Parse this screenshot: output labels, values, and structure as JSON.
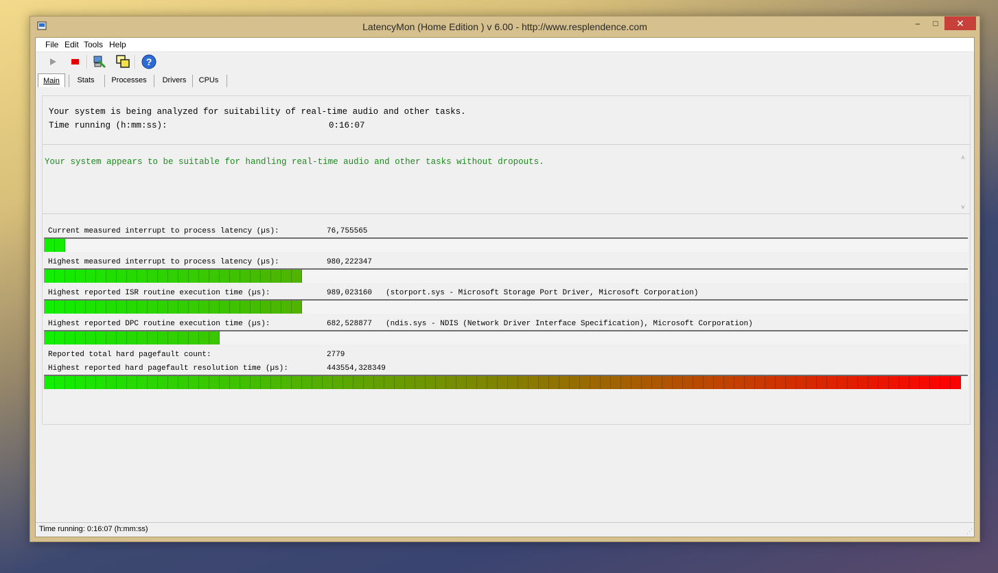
{
  "window": {
    "title": "LatencyMon  (Home Edition )  v 6.00 - http://www.resplendence.com",
    "min_glyph": "–",
    "max_glyph": "□",
    "close_glyph": "✕"
  },
  "menu": [
    "File",
    "Edit",
    "Tools",
    "Help"
  ],
  "toolbar": {
    "icons": [
      "play-icon",
      "stop-icon",
      "pc-tools-icon",
      "windows-icon",
      "help-icon"
    ],
    "help_glyph": "?"
  },
  "tabs": [
    "Main",
    "Stats",
    "Processes",
    "Drivers",
    "CPUs"
  ],
  "active_tab": "Main",
  "main": {
    "analyzing_text": "Your system is being analyzed for suitability of real-time audio and other tasks.",
    "time_label": "Time running (h:mm:ss):",
    "time_value": "0:16:07",
    "verdict": "Your system appears to be suitable for handling real-time audio and other tasks without dropouts.",
    "metrics": [
      {
        "label": "Current measured interrupt to process latency (µs):",
        "value": "76,755565",
        "driver": "",
        "level": 0.02
      },
      {
        "label": "Highest measured interrupt to process latency (µs):",
        "value": "980,222347",
        "driver": "",
        "level": 0.28
      },
      {
        "label": "Highest reported ISR routine execution time (µs):",
        "value": "989,023160",
        "driver": "(storport.sys - Microsoft Storage Port Driver, Microsoft Corporation)",
        "level": 0.28
      },
      {
        "label": "Highest reported DPC routine execution time (µs):",
        "value": "682,528877",
        "driver": "(ndis.sys - NDIS (Network Driver Interface Specification), Microsoft Corporation)",
        "level": 0.19
      }
    ],
    "pagefault_count_label": "Reported total hard pagefault count:",
    "pagefault_count_value": "2779",
    "pagefault_time_label": "Highest reported hard pagefault resolution time (µs):",
    "pagefault_time_value": "443554,328349",
    "pagefault_level": 1.0
  },
  "status": {
    "text": "Time running: 0:16:07  (h:mm:ss)"
  },
  "colors": {
    "ok_text": "#1c8b1c",
    "meter_green": "#11ee11",
    "meter_red": "#ff0000",
    "stop_red": "#e00000",
    "close_red": "#c7403a"
  }
}
